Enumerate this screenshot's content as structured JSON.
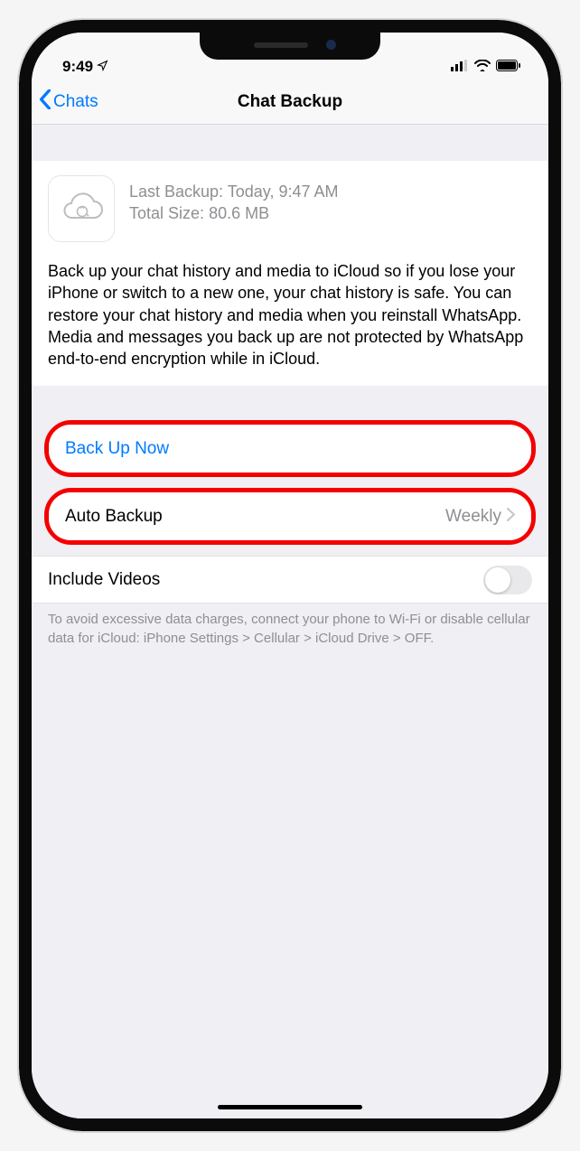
{
  "status": {
    "time": "9:49",
    "location_icon": "location-arrow"
  },
  "nav": {
    "back_label": "Chats",
    "title": "Chat Backup"
  },
  "info": {
    "last_backup_label": "Last Backup:",
    "last_backup_value": "Today, 9:47 AM",
    "total_size_label": "Total Size:",
    "total_size_value": "80.6 MB",
    "description": "Back up your chat history and media to iCloud so if you lose your iPhone or switch to a new one, your chat history is safe. You can restore your chat history and media when you reinstall WhatsApp. Media and messages you back up are not protected by WhatsApp end-to-end encryption while in iCloud."
  },
  "actions": {
    "backup_now": "Back Up Now",
    "auto_backup_label": "Auto Backup",
    "auto_backup_value": "Weekly",
    "include_videos_label": "Include Videos",
    "include_videos_on": false
  },
  "footer": "To avoid excessive data charges, connect your phone to Wi-Fi or disable cellular data for iCloud: iPhone Settings > Cellular > iCloud Drive > OFF."
}
